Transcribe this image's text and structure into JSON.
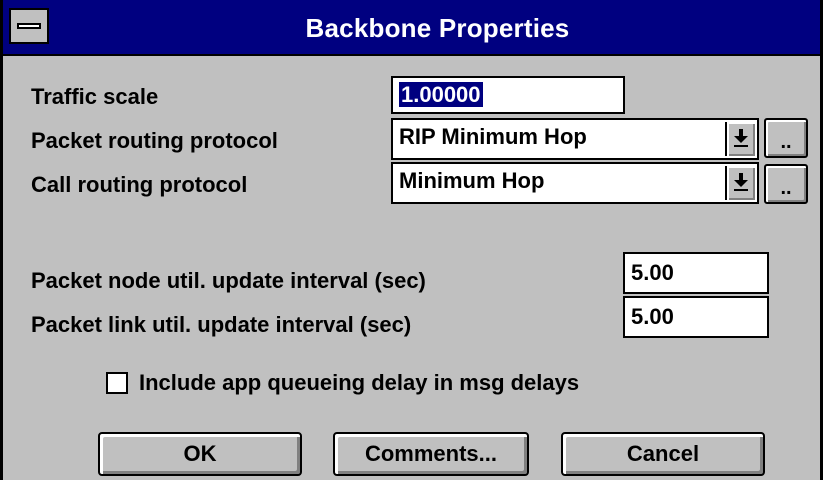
{
  "window": {
    "title": "Backbone Properties",
    "system_menu_icon": "system-menu-icon"
  },
  "form": {
    "traffic_scale": {
      "label": "Traffic scale",
      "value": "1.00000"
    },
    "packet_routing": {
      "label": "Packet routing protocol",
      "value": "RIP Minimum Hop",
      "more_label": ".."
    },
    "call_routing": {
      "label": "Call routing protocol",
      "value": "Minimum Hop",
      "more_label": ".."
    },
    "packet_node_interval": {
      "label": "Packet node util. update interval (sec)",
      "value": "5.00"
    },
    "packet_link_interval": {
      "label": "Packet link util. update interval (sec)",
      "value": "5.00"
    },
    "include_app_queueing": {
      "label": "Include app queueing delay in msg delays",
      "checked": false
    }
  },
  "buttons": {
    "ok": "OK",
    "comments": "Comments...",
    "cancel": "Cancel"
  },
  "colors": {
    "titlebar": "#000080",
    "face": "#c0c0c0",
    "selection": "#000080"
  }
}
